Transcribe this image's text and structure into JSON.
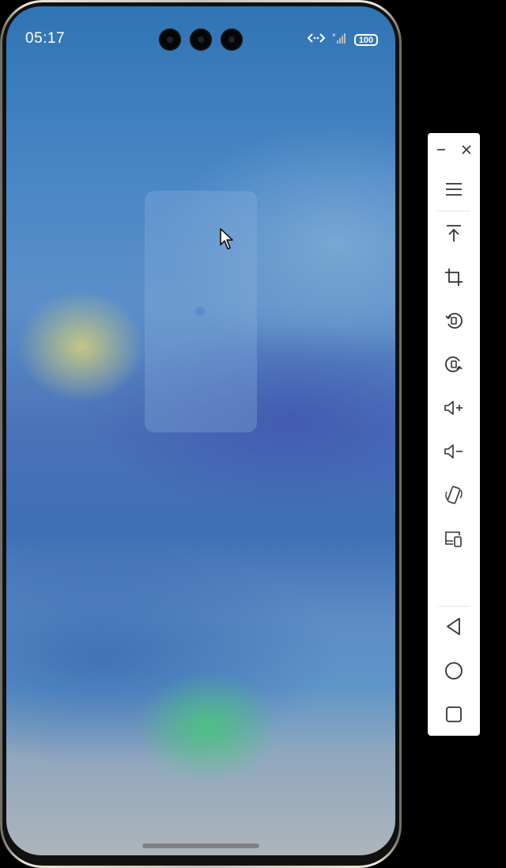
{
  "status_bar": {
    "time": "05:17",
    "battery": "100"
  },
  "icons": {
    "signal": "signal-bars-icon",
    "data_transfer": "data-arrows-icon",
    "battery": "battery-icon",
    "cursor": "mouse-pointer-icon"
  },
  "toolbar": {
    "items": [
      {
        "name": "minimize",
        "icon": "minimize-icon"
      },
      {
        "name": "close",
        "icon": "close-icon"
      },
      {
        "name": "menu",
        "icon": "menu-icon"
      },
      {
        "name": "pin-to-top",
        "icon": "arrow-to-top-icon"
      },
      {
        "name": "screenshot-crop",
        "icon": "crop-icon"
      },
      {
        "name": "rotate-left",
        "icon": "rotate-left-icon"
      },
      {
        "name": "rotate-right",
        "icon": "rotate-right-icon"
      },
      {
        "name": "volume-up",
        "icon": "volume-up-icon"
      },
      {
        "name": "volume-down",
        "icon": "volume-down-icon"
      },
      {
        "name": "shake",
        "icon": "shake-device-icon"
      },
      {
        "name": "device-switch",
        "icon": "devices-icon"
      },
      {
        "name": "back",
        "icon": "back-triangle-icon"
      },
      {
        "name": "home",
        "icon": "home-circle-icon"
      },
      {
        "name": "recents",
        "icon": "recents-square-icon"
      }
    ]
  },
  "colors": {
    "toolbar_bg": "#ffffff",
    "icon_stroke": "#333333",
    "wallpaper_top": "#2f74b4",
    "wallpaper_bottom": "#aeb4bb"
  }
}
